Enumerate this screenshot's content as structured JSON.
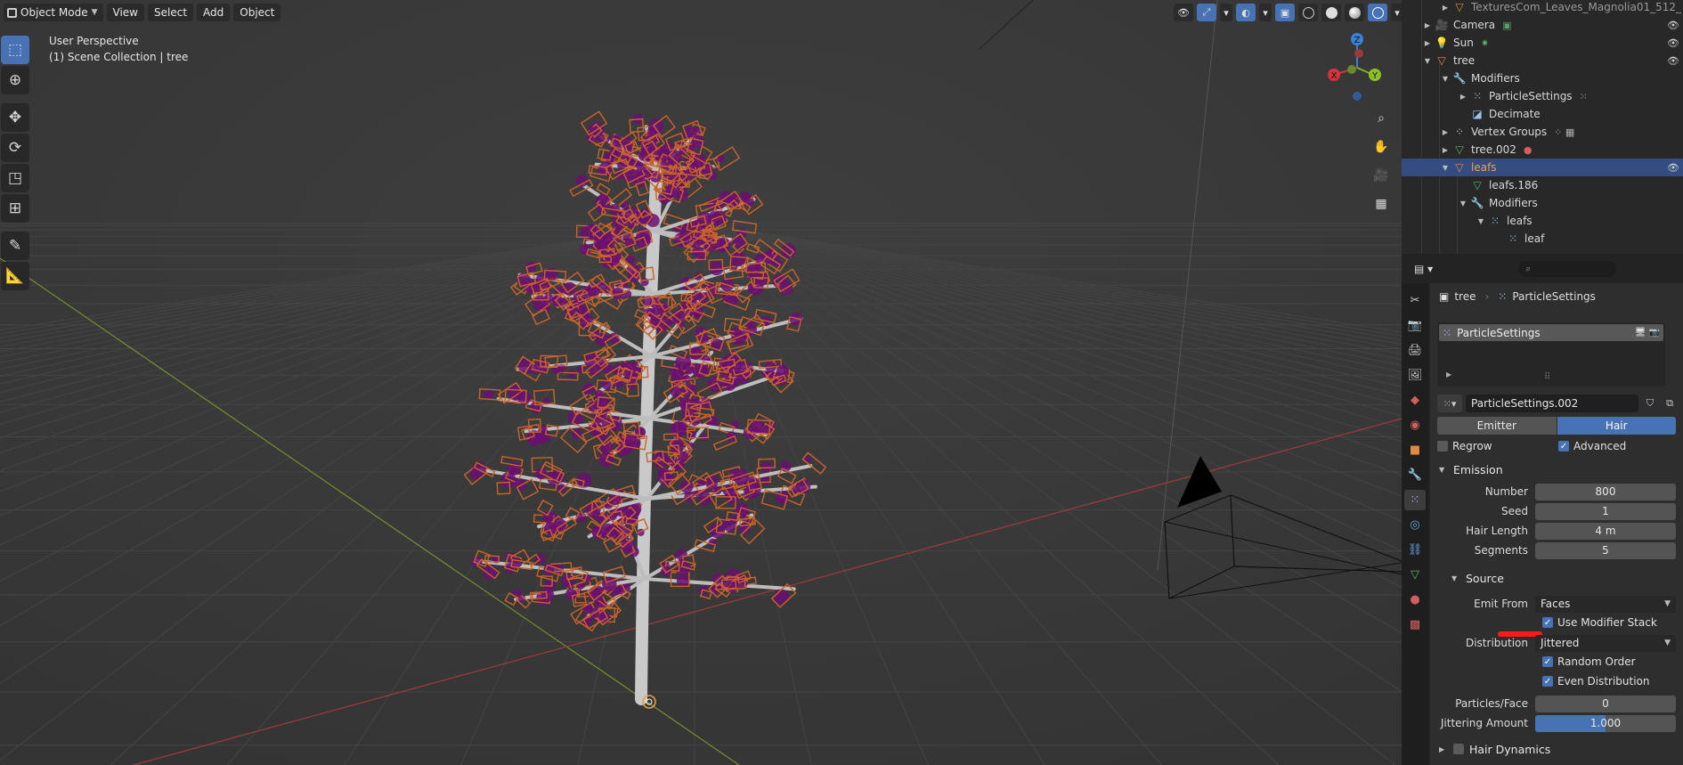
{
  "viewport": {
    "mode_label": "Object Mode",
    "menus": [
      "View",
      "Select",
      "Add",
      "Object"
    ],
    "info_line1": "User Perspective",
    "info_line2": "(1) Scene Collection | tree",
    "gizmo": {
      "x": "X",
      "y": "Y",
      "z": "Z"
    }
  },
  "outliner": {
    "rows": [
      {
        "name": "TexturesCom_Leaves_Magnolia01_512_"
      },
      {
        "name": "Camera"
      },
      {
        "name": "Sun"
      },
      {
        "name": "tree"
      },
      {
        "name": "Modifiers"
      },
      {
        "name": "ParticleSettings"
      },
      {
        "name": "Decimate"
      },
      {
        "name": "Vertex Groups"
      },
      {
        "name": "tree.002"
      },
      {
        "name": "leafs"
      },
      {
        "name": "leafs.186"
      },
      {
        "name": "Modifiers"
      },
      {
        "name": "leafs"
      },
      {
        "name": "leaf"
      }
    ]
  },
  "properties": {
    "search_placeholder": "",
    "breadcrumb": {
      "object": "tree",
      "settings": "ParticleSettings"
    },
    "particle_system": "ParticleSettings",
    "settings_name": "ParticleSettings.002",
    "type_emitter": "Emitter",
    "type_hair": "Hair",
    "regrow_label": "Regrow",
    "advanced_label": "Advanced",
    "emission": {
      "title": "Emission",
      "number_label": "Number",
      "number": "800",
      "seed_label": "Seed",
      "seed": "1",
      "hair_length_label": "Hair Length",
      "hair_length": "4 m",
      "segments_label": "Segments",
      "segments": "5"
    },
    "source": {
      "title": "Source",
      "emit_from_label": "Emit From",
      "emit_from": "Faces",
      "use_modifier_stack": "Use Modifier Stack",
      "distribution_label": "Distribution",
      "distribution": "Jittered",
      "random_order": "Random Order",
      "even_distribution": "Even Distribution",
      "particles_face_label": "Particles/Face",
      "particles_face": "0",
      "jitter_label": "Jittering Amount",
      "jitter": "1.000",
      "jitter_fraction": 0.5
    },
    "hair_dynamics": "Hair Dynamics"
  },
  "colors": {
    "accent": "#4772b3",
    "selection": "#334d80",
    "leaf_orange": "#c8642a",
    "leaf_purple": "#6a1070"
  }
}
